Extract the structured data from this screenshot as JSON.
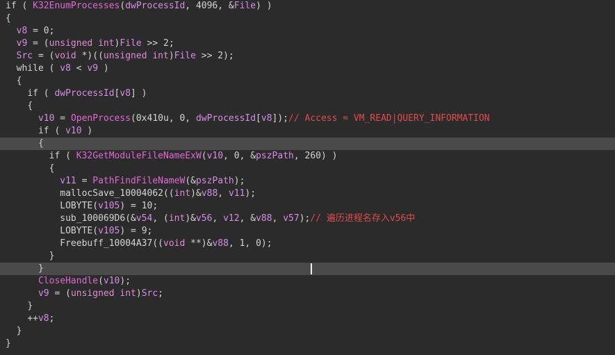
{
  "editor": {
    "cursor_line": 22,
    "lines": [
      {
        "indent": "",
        "tokens": [
          {
            "t": "kw",
            "v": "if ( "
          },
          {
            "t": "fn",
            "v": "K32EnumProcesses"
          },
          {
            "t": "kw",
            "v": "("
          },
          {
            "t": "var",
            "v": "dwProcessId"
          },
          {
            "t": "kw",
            "v": ", 4096, &"
          },
          {
            "t": "var",
            "v": "File"
          },
          {
            "t": "kw",
            "v": ") )"
          }
        ]
      },
      {
        "indent": "",
        "tokens": [
          {
            "t": "kw",
            "v": "{"
          }
        ]
      },
      {
        "indent": "  ",
        "tokens": [
          {
            "t": "var",
            "v": "v8"
          },
          {
            "t": "kw",
            "v": " = 0;"
          }
        ]
      },
      {
        "indent": "  ",
        "tokens": [
          {
            "t": "var",
            "v": "v9"
          },
          {
            "t": "kw",
            "v": " = ("
          },
          {
            "t": "typ",
            "v": "unsigned int"
          },
          {
            "t": "kw",
            "v": ")"
          },
          {
            "t": "var",
            "v": "File"
          },
          {
            "t": "kw",
            "v": " >> 2;"
          }
        ]
      },
      {
        "indent": "  ",
        "tokens": [
          {
            "t": "var",
            "v": "Src"
          },
          {
            "t": "kw",
            "v": " = ("
          },
          {
            "t": "typ",
            "v": "void"
          },
          {
            "t": "kw",
            "v": " *)(("
          },
          {
            "t": "typ",
            "v": "unsigned int"
          },
          {
            "t": "kw",
            "v": ")"
          },
          {
            "t": "var",
            "v": "File"
          },
          {
            "t": "kw",
            "v": " >> 2);"
          }
        ]
      },
      {
        "indent": "  ",
        "tokens": [
          {
            "t": "kw",
            "v": "while ( "
          },
          {
            "t": "var",
            "v": "v8"
          },
          {
            "t": "kw",
            "v": " < "
          },
          {
            "t": "var",
            "v": "v9"
          },
          {
            "t": "kw",
            "v": " )"
          }
        ]
      },
      {
        "indent": "  ",
        "tokens": [
          {
            "t": "kw",
            "v": "{"
          }
        ]
      },
      {
        "indent": "    ",
        "tokens": [
          {
            "t": "kw",
            "v": "if ( "
          },
          {
            "t": "var",
            "v": "dwProcessId"
          },
          {
            "t": "kw",
            "v": "["
          },
          {
            "t": "var",
            "v": "v8"
          },
          {
            "t": "kw",
            "v": "] )"
          }
        ]
      },
      {
        "indent": "    ",
        "tokens": [
          {
            "t": "kw",
            "v": "{"
          }
        ]
      },
      {
        "indent": "      ",
        "tokens": [
          {
            "t": "var",
            "v": "v10"
          },
          {
            "t": "kw",
            "v": " = "
          },
          {
            "t": "fn",
            "v": "OpenProcess"
          },
          {
            "t": "kw",
            "v": "(0x410u, 0, "
          },
          {
            "t": "var",
            "v": "dwProcessId"
          },
          {
            "t": "kw",
            "v": "["
          },
          {
            "t": "var",
            "v": "v8"
          },
          {
            "t": "kw",
            "v": "]);"
          },
          {
            "t": "cmt",
            "v": "// Access = VM_READ|QUERY_INFORMATION"
          }
        ]
      },
      {
        "indent": "      ",
        "tokens": [
          {
            "t": "kw",
            "v": "if ( "
          },
          {
            "t": "var",
            "v": "v10"
          },
          {
            "t": "kw",
            "v": " )"
          }
        ]
      },
      {
        "indent": "      ",
        "hl": true,
        "tokens": [
          {
            "t": "kw",
            "v": "{"
          }
        ]
      },
      {
        "indent": "        ",
        "tokens": [
          {
            "t": "kw",
            "v": "if ( "
          },
          {
            "t": "fn",
            "v": "K32GetModuleFileNameExW"
          },
          {
            "t": "kw",
            "v": "("
          },
          {
            "t": "var",
            "v": "v10"
          },
          {
            "t": "kw",
            "v": ", 0, &"
          },
          {
            "t": "var",
            "v": "pszPath"
          },
          {
            "t": "kw",
            "v": ", 260) )"
          }
        ]
      },
      {
        "indent": "        ",
        "tokens": [
          {
            "t": "kw",
            "v": "{"
          }
        ]
      },
      {
        "indent": "          ",
        "tokens": [
          {
            "t": "var",
            "v": "v11"
          },
          {
            "t": "kw",
            "v": " = "
          },
          {
            "t": "fn",
            "v": "PathFindFileNameW"
          },
          {
            "t": "kw",
            "v": "(&"
          },
          {
            "t": "var",
            "v": "pszPath"
          },
          {
            "t": "kw",
            "v": ");"
          }
        ]
      },
      {
        "indent": "          ",
        "tokens": [
          {
            "t": "kw",
            "v": "mallocSave_10004062(("
          },
          {
            "t": "typ",
            "v": "int"
          },
          {
            "t": "kw",
            "v": ")&"
          },
          {
            "t": "var",
            "v": "v88"
          },
          {
            "t": "kw",
            "v": ", "
          },
          {
            "t": "var",
            "v": "v11"
          },
          {
            "t": "kw",
            "v": ");"
          }
        ]
      },
      {
        "indent": "          ",
        "tokens": [
          {
            "t": "kw",
            "v": "LOBYTE("
          },
          {
            "t": "var",
            "v": "v105"
          },
          {
            "t": "kw",
            "v": ") = 10;"
          }
        ]
      },
      {
        "indent": "          ",
        "tokens": [
          {
            "t": "kw",
            "v": "sub_100069D6(&"
          },
          {
            "t": "var",
            "v": "v54"
          },
          {
            "t": "kw",
            "v": ", ("
          },
          {
            "t": "typ",
            "v": "int"
          },
          {
            "t": "kw",
            "v": ")&"
          },
          {
            "t": "var",
            "v": "v56"
          },
          {
            "t": "kw",
            "v": ", "
          },
          {
            "t": "var",
            "v": "v12"
          },
          {
            "t": "kw",
            "v": ", &"
          },
          {
            "t": "var",
            "v": "v88"
          },
          {
            "t": "kw",
            "v": ", "
          },
          {
            "t": "var",
            "v": "v57"
          },
          {
            "t": "kw",
            "v": ");"
          },
          {
            "t": "cmt",
            "v": "// 遍历进程名存入v56中"
          }
        ]
      },
      {
        "indent": "          ",
        "tokens": [
          {
            "t": "kw",
            "v": "LOBYTE("
          },
          {
            "t": "var",
            "v": "v105"
          },
          {
            "t": "kw",
            "v": ") = 9;"
          }
        ]
      },
      {
        "indent": "          ",
        "tokens": [
          {
            "t": "kw",
            "v": "Freebuff_10004A37(("
          },
          {
            "t": "typ",
            "v": "void"
          },
          {
            "t": "kw",
            "v": " **)&"
          },
          {
            "t": "var",
            "v": "v88"
          },
          {
            "t": "kw",
            "v": ", 1, 0);"
          }
        ]
      },
      {
        "indent": "        ",
        "tokens": [
          {
            "t": "kw",
            "v": "}"
          }
        ]
      },
      {
        "indent": "      ",
        "hl": true,
        "cursor": true,
        "tokens": [
          {
            "t": "kw",
            "v": "}"
          }
        ]
      },
      {
        "indent": "      ",
        "tokens": [
          {
            "t": "fn",
            "v": "CloseHandle"
          },
          {
            "t": "kw",
            "v": "("
          },
          {
            "t": "var",
            "v": "v10"
          },
          {
            "t": "kw",
            "v": ");"
          }
        ]
      },
      {
        "indent": "      ",
        "tokens": [
          {
            "t": "var",
            "v": "v9"
          },
          {
            "t": "kw",
            "v": " = ("
          },
          {
            "t": "typ",
            "v": "unsigned int"
          },
          {
            "t": "kw",
            "v": ")"
          },
          {
            "t": "var",
            "v": "Src"
          },
          {
            "t": "kw",
            "v": ";"
          }
        ]
      },
      {
        "indent": "    ",
        "tokens": [
          {
            "t": "kw",
            "v": "}"
          }
        ]
      },
      {
        "indent": "    ",
        "tokens": [
          {
            "t": "kw",
            "v": "++"
          },
          {
            "t": "var",
            "v": "v8"
          },
          {
            "t": "kw",
            "v": ";"
          }
        ]
      },
      {
        "indent": "  ",
        "tokens": [
          {
            "t": "kw",
            "v": "}"
          }
        ]
      },
      {
        "indent": "",
        "tokens": [
          {
            "t": "kw",
            "v": "}"
          }
        ]
      }
    ]
  },
  "colors": {
    "background": "#2b2b2b",
    "highlight_line": "#4a4a4a",
    "text": "#d4d4d4",
    "identifier": "#d68de8",
    "function": "#e069d6",
    "type": "#e08bd6",
    "comment": "#e04b4b"
  }
}
